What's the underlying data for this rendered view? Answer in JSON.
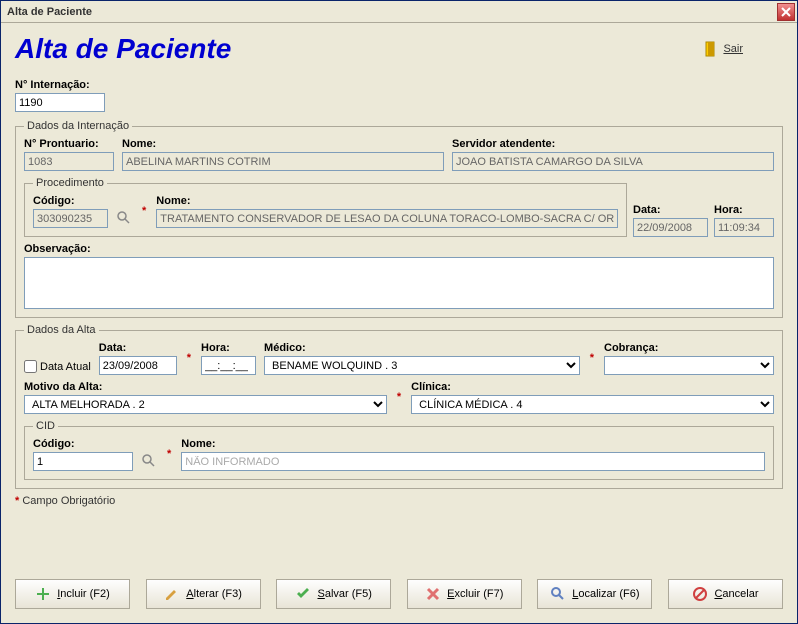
{
  "window_title": "Alta de Paciente",
  "page_title": "Alta de Paciente",
  "sair_label": "Sair",
  "internacao": {
    "label": "N° Internação:",
    "value": "1190"
  },
  "dados_internacao": {
    "legend": "Dados da Internação",
    "prontuario_label": "N° Prontuario:",
    "prontuario_value": "1083",
    "nome_label": "Nome:",
    "nome_value": "ABELINA MARTINS COTRIM",
    "servidor_label": "Servidor atendente:",
    "servidor_value": "JOAO BATISTA CAMARGO DA SILVA",
    "procedimento": {
      "legend": "Procedimento",
      "codigo_label": "Código:",
      "codigo_value": "303090235",
      "nome_label": "Nome:",
      "nome_value": "TRATAMENTO CONSERVADOR DE LESAO DA COLUNA TORACO-LOMBO-SACRA C/ ORTESE"
    },
    "data_label": "Data:",
    "data_value": "22/09/2008",
    "hora_label": "Hora:",
    "hora_value": "11:09:34",
    "observacao_label": "Observação:",
    "observacao_value": ""
  },
  "dados_alta": {
    "legend": "Dados da Alta",
    "data_atual_label": "Data Atual",
    "data_label": "Data:",
    "data_value": "23/09/2008",
    "hora_label": "Hora:",
    "hora_value": "__:__:__",
    "medico_label": "Médico:",
    "medico_value": "BENAME WOLQUIND . 3",
    "cobranca_label": "Cobrança:",
    "cobranca_value": "",
    "motivo_label": "Motivo da Alta:",
    "motivo_value": "ALTA MELHORADA . 2",
    "clinica_label": "Clínica:",
    "clinica_value": "CLÍNICA MÉDICA . 4",
    "cid": {
      "legend": "CID",
      "codigo_label": "Código:",
      "codigo_value": "1",
      "nome_label": "Nome:",
      "nome_value": "NÃO INFORMADO"
    }
  },
  "required_note": "Campo Obrigatório",
  "buttons": {
    "incluir": "Incluir (F2)",
    "alterar": "Alterar (F3)",
    "salvar": "Salvar (F5)",
    "excluir": "Excluir (F7)",
    "localizar": "Localizar (F6)",
    "cancelar": "Cancelar"
  }
}
